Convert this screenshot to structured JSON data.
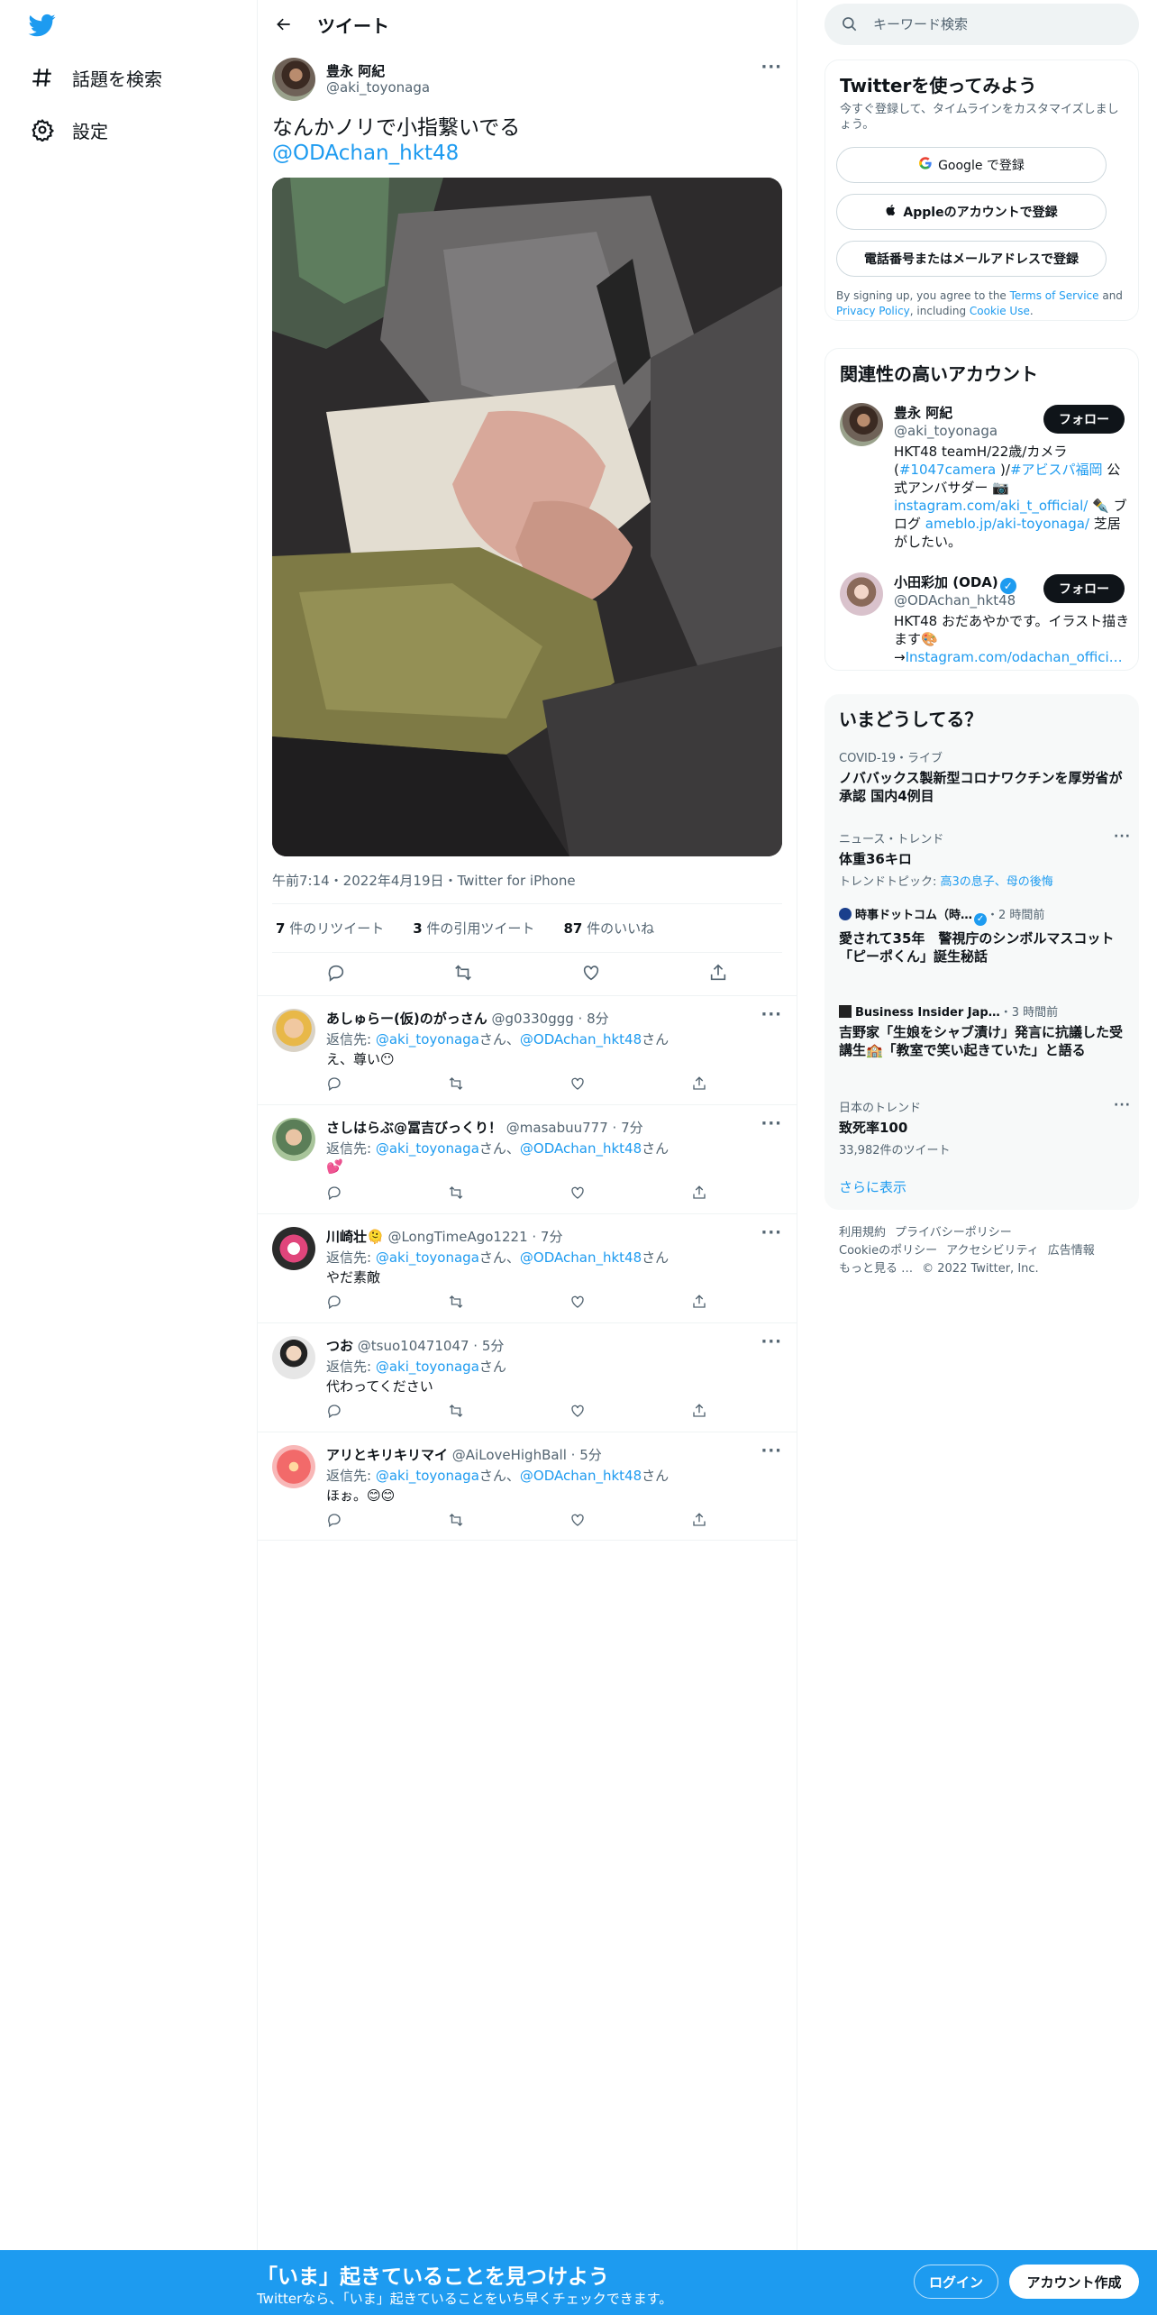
{
  "nav": {
    "explore_label": "話題を検索",
    "settings_label": "設定"
  },
  "header": {
    "title": "ツイート"
  },
  "tweet": {
    "author_name": "豊永 阿紀",
    "author_handle": "@aki_toyonaga",
    "text": "なんかノリで小指繋いでる",
    "mention": "@ODAchan_hkt48",
    "meta": "午前7:14・2022年4月19日・Twitter for iPhone",
    "retweets_count": "7",
    "retweets_label": " 件のリツイート",
    "quotes_count": "3",
    "quotes_label": " 件の引用ツイート",
    "likes_count": "87",
    "likes_label": " 件のいいね"
  },
  "replies": [
    {
      "name": "あしゅらー(仮)のがっさん",
      "handle": "@g0330ggg · 8分",
      "to_prefix": "返信先: ",
      "to1": "@aki_toyonaga",
      "mid": "さん、",
      "to2": "@ODAchan_hkt48",
      "suffix": "さん",
      "text": "え、尊い😶"
    },
    {
      "name": "さしはらぶ@冨吉びっくり！",
      "handle": "@masabuu777 · 7分",
      "to_prefix": "返信先: ",
      "to1": "@aki_toyonaga",
      "mid": "さん、",
      "to2": "@ODAchan_hkt48",
      "suffix": "さん",
      "text": "💕"
    },
    {
      "name": "川崎壮🫠",
      "handle": "@LongTimeAgo1221 · 7分",
      "to_prefix": "返信先: ",
      "to1": "@aki_toyonaga",
      "mid": "さん、",
      "to2": "@ODAchan_hkt48",
      "suffix": "さん",
      "text": "やだ素敵"
    },
    {
      "name": "つお",
      "handle": "@tsuo10471047 · 5分",
      "to_prefix": "返信先: ",
      "to1": "@aki_toyonaga",
      "mid": "さん",
      "to2": "",
      "suffix": "",
      "text": "代わってください"
    },
    {
      "name": "アリとキリキリマイ",
      "handle": "@AiLoveHighBall · 5分",
      "to_prefix": "返信先: ",
      "to1": "@aki_toyonaga",
      "mid": "さん、",
      "to2": "@ODAchan_hkt48",
      "suffix": "さん",
      "text": "ほぉ。😊😊"
    }
  ],
  "search": {
    "placeholder": "キーワード検索"
  },
  "signup": {
    "title": "Twitterを使ってみよう",
    "subtitle": "今すぐ登録して、タイムラインをカスタマイズしましょう。",
    "google": "Google で登録",
    "apple": "Appleのアカウントで登録",
    "phone": "電話番号またはメールアドレスで登録",
    "legal_1": "By signing up, you agree to the ",
    "terms": "Terms of Service",
    "legal_2": " and ",
    "privacy": "Privacy Policy",
    "legal_3": ", including ",
    "cookie": "Cookie Use",
    "legal_4": "."
  },
  "related": {
    "title": "関連性の高いアカウント",
    "follow_label": "フォロー",
    "accounts": [
      {
        "name": "豊永 阿紀",
        "handle": "@aki_toyonaga",
        "bio_1": "HKT48 teamH/22歳/カメラ(",
        "bio_tag1": "#1047camera",
        "bio_2": " )/",
        "bio_tag2": "#アビスパ福岡",
        "bio_3": " 公式アンバサダー 📷 ",
        "bio_link1": "instagram.com/aki_t_official/",
        "bio_4": " ✒️ ブログ ",
        "bio_link2": "ameblo.jp/aki-toyonaga/",
        "bio_5": " 芝居がしたい。"
      },
      {
        "name": "小田彩加 (ODA)",
        "handle": "@ODAchan_hkt48",
        "bio_1": "HKT48 おだあやかです。イラスト描きます🎨",
        "bio_2": "→",
        "bio_link1": "Instagram.com/odachan_offici…"
      }
    ]
  },
  "trends": {
    "title": "いまどうしてる？",
    "items": [
      {
        "category": "COVID-19・ライブ",
        "title": "ノババックス製新型コロナワクチンを厚労省が承認 国内4例目",
        "sub": ""
      },
      {
        "category": "ニュース・トレンド",
        "title": "体重36キロ",
        "sub_prefix": "トレンドトピック: ",
        "sub_links": "高3の息子、母の後悔"
      },
      {
        "category": "時事ドットコム（時…",
        "cat_suffix": "・2 時間前",
        "title": "愛されて35年　警視庁のシンボルマスコット「ピーポくん」誕生秘話"
      },
      {
        "category": "Business Insider Jap…",
        "cat_suffix": "・3 時間前",
        "title": "吉野家「生娘をシャブ漬け」発言に抗議した受講生🏫「教室で笑い起きていた」と語る"
      },
      {
        "category": "日本のトレンド",
        "title": "致死率100",
        "sub": "33,982件のツイート"
      }
    ],
    "show_more": "さらに表示"
  },
  "footer": {
    "terms": "利用規約",
    "privacy": "プライバシーポリシー",
    "cookie": "Cookieのポリシー",
    "accessibility": "アクセシビリティ",
    "ads": "広告情報",
    "more": "もっと見る …",
    "copyright": "© 2022 Twitter, Inc."
  },
  "bottom_bar": {
    "title": "「いま」起きていることを見つけよう",
    "subtitle": "Twitterなら、「いま」起きていることをいち早くチェックできます。",
    "login": "ログイン",
    "signup": "アカウント作成"
  },
  "colors": {
    "accent": "#1d9bf0",
    "text": "#0f1419",
    "muted": "#536471"
  }
}
